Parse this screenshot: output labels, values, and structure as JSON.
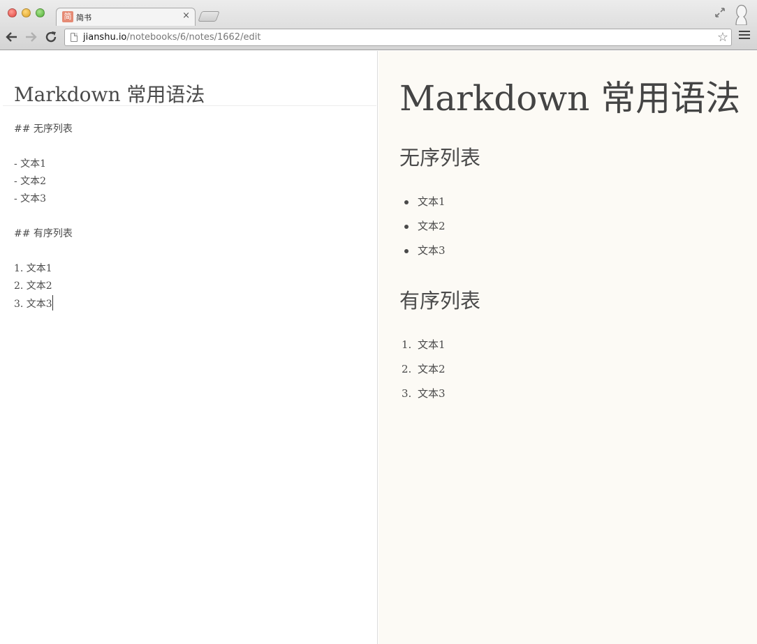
{
  "browser": {
    "tab_title": "简书",
    "tab_favicon": "简",
    "tab_close": "×",
    "url_host": "jianshu.io",
    "url_path": "/notebooks/6/notes/1662/edit",
    "icons": [
      "close-window-icon",
      "minimize-icon",
      "zoom-icon",
      "back-arrow-icon",
      "forward-arrow-icon",
      "reload-icon",
      "page-icon",
      "star-icon",
      "menu-icon",
      "fullscreen-icon",
      "profile-icon"
    ]
  },
  "editor": {
    "title": "Markdown 常用语法",
    "lines": [
      "## 无序列表",
      "",
      "- 文本1",
      "- 文本2",
      "- 文本3",
      "",
      "## 有序列表",
      "",
      "1. 文本1",
      "2. 文本2",
      "3. 文本3"
    ]
  },
  "preview": {
    "title": "Markdown 常用语法",
    "unordered_heading": "无序列表",
    "unordered_items": [
      "文本1",
      "文本2",
      "文本3"
    ],
    "ordered_heading": "有序列表",
    "ordered_items": [
      "文本1",
      "文本2",
      "文本3"
    ],
    "ordered_numbers": [
      "1.",
      "2.",
      "3."
    ]
  },
  "colors": {
    "preview_bg": "#fcfaf5",
    "text": "#4a4a4a",
    "favicon": "#e58a74"
  }
}
